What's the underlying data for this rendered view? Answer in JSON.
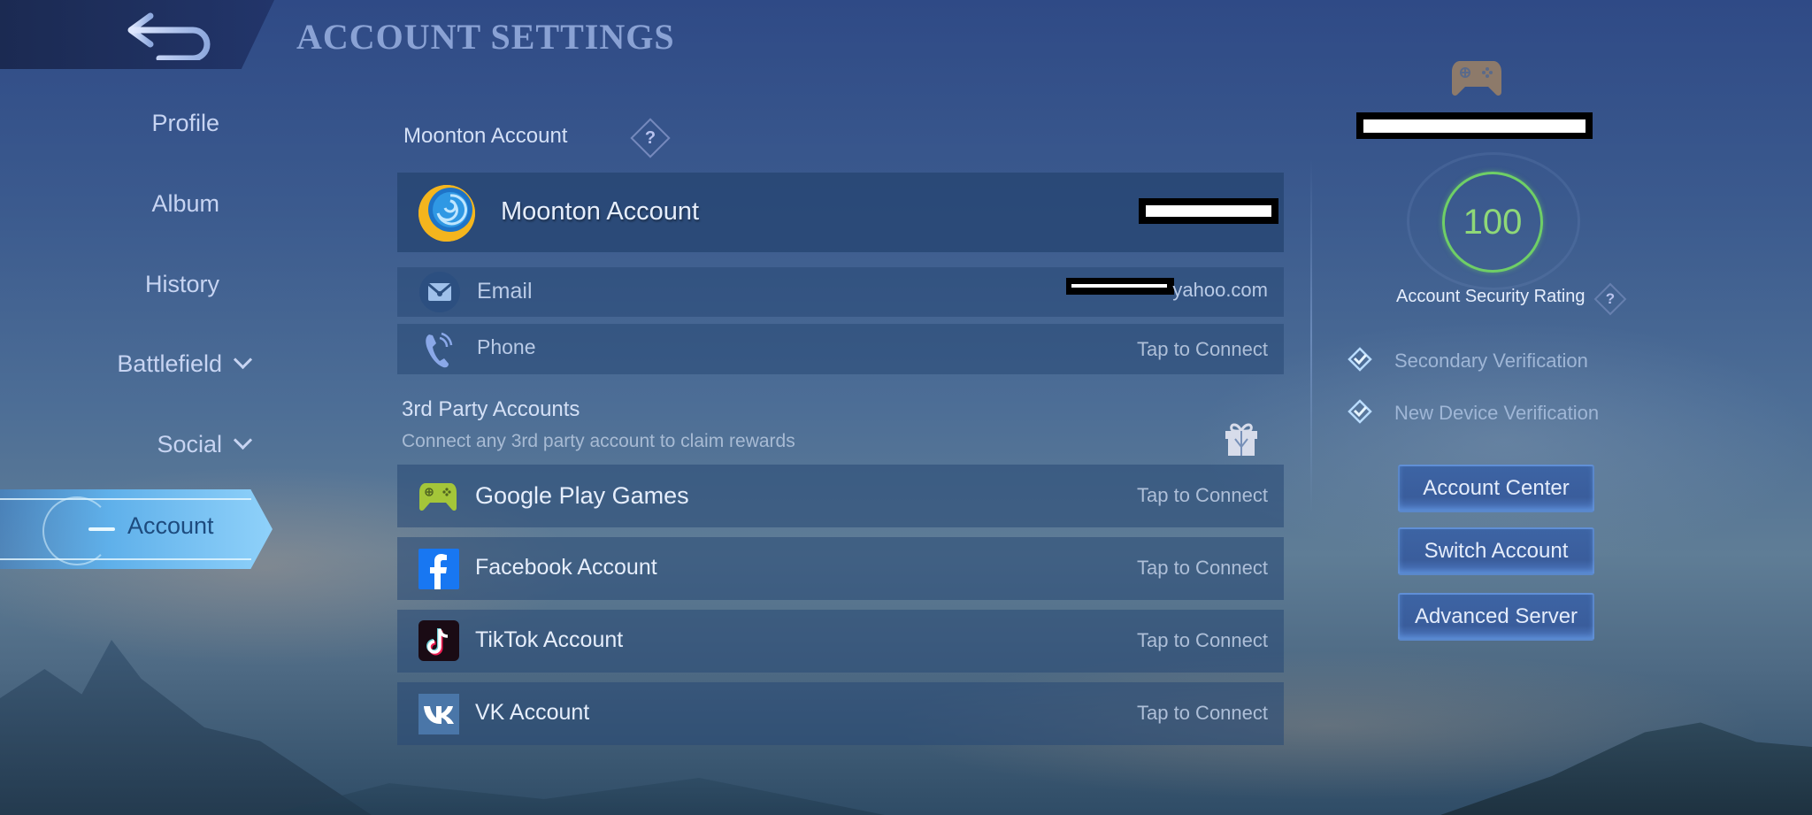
{
  "header": {
    "title": "ACCOUNT SETTINGS",
    "back_icon": "back-arrow-icon"
  },
  "sidebar": {
    "items": [
      {
        "label": "Profile",
        "expandable": false,
        "active": false
      },
      {
        "label": "Album",
        "expandable": false,
        "active": false
      },
      {
        "label": "History",
        "expandable": false,
        "active": false
      },
      {
        "label": "Battlefield",
        "expandable": true,
        "active": false
      },
      {
        "label": "Social",
        "expandable": true,
        "active": false
      },
      {
        "label": "Account",
        "expandable": false,
        "active": true
      }
    ]
  },
  "moonton": {
    "section_label": "Moonton Account",
    "help_glyph": "?",
    "account_title": "Moonton Account",
    "account_value_redacted": true,
    "email": {
      "label": "Email",
      "value_suffix": "yahoo.com",
      "value_prefix_redacted": true
    },
    "phone": {
      "label": "Phone",
      "status": "Tap to Connect"
    }
  },
  "third_party": {
    "heading": "3rd Party Accounts",
    "subtitle": "Connect any 3rd party account to claim rewards",
    "reward_icon": "gift-icon",
    "accounts": [
      {
        "name": "Google Play Games",
        "status": "Tap to Connect",
        "icon": "google-play-games-icon",
        "color": "#a4c639"
      },
      {
        "name": "Facebook Account",
        "status": "Tap to Connect",
        "icon": "facebook-icon",
        "color": "#1877f2"
      },
      {
        "name": "TikTok Account",
        "status": "Tap to Connect",
        "icon": "tiktok-icon",
        "color": "#1a0b14"
      },
      {
        "name": "VK Account",
        "status": "Tap to Connect",
        "icon": "vk-icon",
        "color": "#4a76a8"
      }
    ]
  },
  "security": {
    "platform_icon": "gamepad-icon",
    "username_redacted": true,
    "rating_value": "100",
    "rating_label": "Account Security Rating",
    "help_glyph": "?",
    "rating_color": "#6fcf66",
    "verifications": [
      {
        "label": "Secondary Verification",
        "enabled": true
      },
      {
        "label": "New Device Verification",
        "enabled": true
      }
    ],
    "buttons": [
      {
        "label": "Account Center"
      },
      {
        "label": "Switch Account"
      },
      {
        "label": "Advanced Server"
      }
    ]
  }
}
